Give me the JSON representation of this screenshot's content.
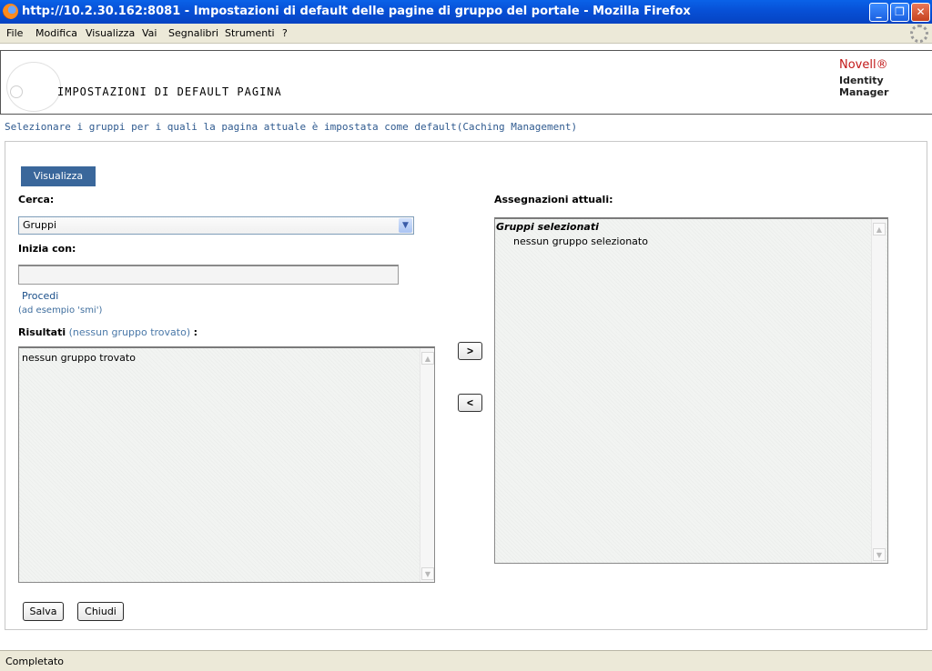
{
  "window": {
    "title": "http://10.2.30.162:8081 - Impostazioni di default delle pagine di gruppo del portale - Mozilla Firefox",
    "minimize": "_",
    "restore": "❐",
    "close": "✕"
  },
  "menubar": {
    "items": [
      {
        "label": "File"
      },
      {
        "label": "Modifica"
      },
      {
        "label": "Visualizza"
      },
      {
        "label": "Vai"
      },
      {
        "label": "Segnalibri"
      },
      {
        "label": "Strumenti"
      },
      {
        "label": "?"
      }
    ]
  },
  "header": {
    "page_title": "IMPOSTAZIONI DI DEFAULT PAGINA",
    "brand": "Novell®",
    "product": "Identity Manager"
  },
  "subtitle": "Selezionare i gruppi per i quali la pagina attuale è impostata come default(Caching Management)",
  "tab": {
    "label": "Visualizza"
  },
  "search": {
    "label": "Cerca:",
    "selected": "Gruppi",
    "starts_with_label": "Inizia con:",
    "starts_with_value": "",
    "go_link": "Procedi",
    "hint": "(ad esempio 'smi')"
  },
  "results": {
    "label": "Risultati",
    "count_text": "(nessun gruppo trovato)",
    "colon": ":",
    "items": [
      "nessun gruppo trovato"
    ]
  },
  "move": {
    "add": ">",
    "remove": "<"
  },
  "assignments": {
    "label": "Assegnazioni attuali:",
    "group_header": "Gruppi selezionati",
    "items": [
      "nessun gruppo selezionato"
    ]
  },
  "buttons": {
    "save": "Salva",
    "close": "Chiudi"
  },
  "status": "Completato",
  "icons": {
    "app": "firefox-icon",
    "scroll_up": "▲",
    "scroll_down": "▼",
    "dropdown": "▼"
  }
}
